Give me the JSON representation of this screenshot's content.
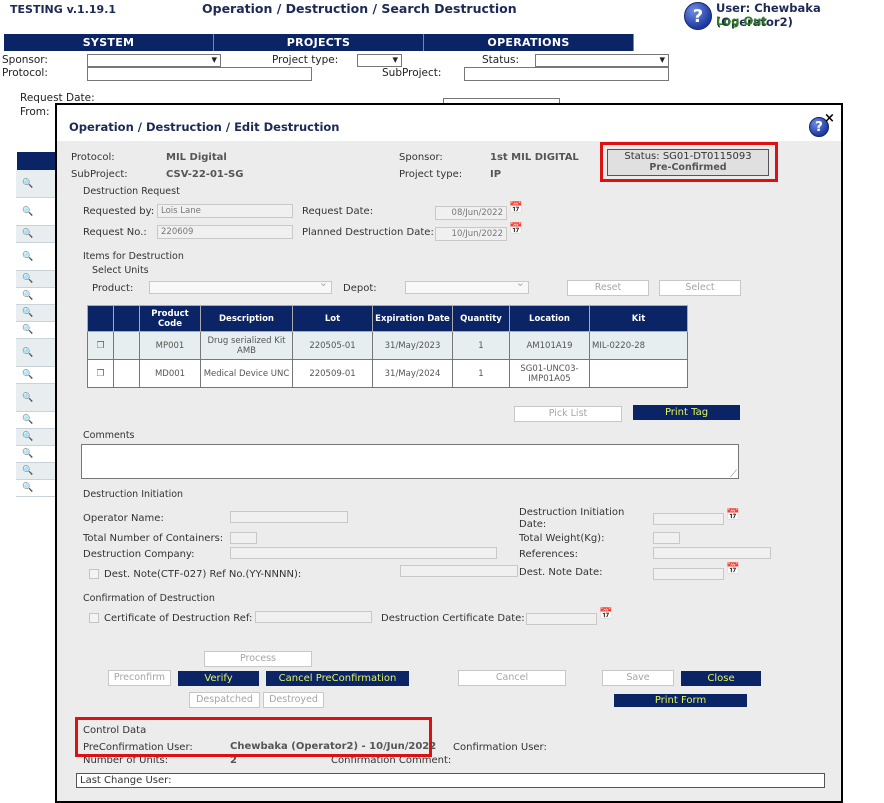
{
  "app": {
    "version": "TESTING v.1.19.1",
    "page_title": "Operation / Destruction / Search Destruction",
    "user": "User: Chewbaka (Operator2)",
    "logout": "Log Out"
  },
  "nav": {
    "tabs": [
      "SYSTEM",
      "PROJECTS",
      "OPERATIONS"
    ]
  },
  "search_form": {
    "sponsor_label": "Sponsor:",
    "project_type_label": "Project type:",
    "status_label": "Status:",
    "protocol_label": "Protocol:",
    "subproject_label": "SubProject:",
    "request_date_label": "Request Date:",
    "from_label": "From:"
  },
  "modal": {
    "title": "Operation / Destruction / Edit Destruction",
    "help": "?",
    "close": "×",
    "protocol_label": "Protocol:",
    "protocol_value": "MIL Digital",
    "subproject_label": "SubProject:",
    "subproject_value": "CSV-22-01-SG",
    "sponsor_label": "Sponsor:",
    "sponsor_value": "1st MIL DIGITAL",
    "project_type_label": "Project type:",
    "project_type_value": "IP",
    "status_text": "Status: SG01-DT0115093",
    "status_sub": "Pre-Confirmed"
  },
  "request": {
    "section": "Destruction Request",
    "requested_by_label": "Requested by:",
    "requested_by_value": "Lois Lane",
    "request_date_label": "Request Date:",
    "request_date_value": "08/Jun/2022",
    "request_no_label": "Request No.:",
    "request_no_value": "220609",
    "planned_date_label": "Planned Destruction Date:",
    "planned_date_value": "10/Jun/2022"
  },
  "items": {
    "section": "Items for Destruction",
    "select_units": "Select Units",
    "product_label": "Product:",
    "depot_label": "Depot:",
    "reset_button": "Reset",
    "select_button": "Select",
    "columns": [
      "Product Code",
      "Description",
      "Lot",
      "Expiration Date",
      "Quantity",
      "Location",
      "Kit"
    ],
    "rows": [
      {
        "code": "MP001",
        "description": "Drug serialized Kit AMB",
        "lot": "220505-01",
        "expiration": "31/May/2023",
        "quantity": "1",
        "location": "AM101A19",
        "kit": "MIL-0220-28"
      },
      {
        "code": "MD001",
        "description": "Medical Device UNC",
        "lot": "220509-01",
        "expiration": "31/May/2024",
        "quantity": "1",
        "location": "SG01-UNC03-IMP01A05",
        "kit": ""
      }
    ],
    "pick_list_button": "Pick List",
    "print_tag_button": "Print Tag"
  },
  "comments": {
    "label": "Comments"
  },
  "initiation": {
    "section": "Destruction Initiation",
    "operator_name_label": "Operator Name:",
    "total_containers_label": "Total Number of Containers:",
    "company_label": "Destruction Company:",
    "dest_note_label": "Dest. Note(CTF-027) Ref No.(YY-NNNN):",
    "initiation_date_label_1": "Destruction Initiation",
    "initiation_date_label_2": "Date:",
    "total_weight_label": "Total Weight(Kg):",
    "references_label": "References:",
    "dest_note_date_label": "Dest. Note Date:"
  },
  "confirmation": {
    "section": "Confirmation of Destruction",
    "certificate_ref_label": "Certificate of Destruction Ref:",
    "certificate_date_label": "Destruction Certificate Date:"
  },
  "actions": {
    "process": "Process",
    "preconfirm": "Preconfirm",
    "verify": "Verify",
    "cancel_preconfirmation": "Cancel PreConfirmation",
    "cancel": "Cancel",
    "save": "Save",
    "close": "Close",
    "despatched": "Despatched",
    "destroyed": "Destroyed",
    "print_form": "Print Form"
  },
  "control": {
    "section": "Control Data",
    "preconfirmation_user_label": "PreConfirmation User:",
    "preconfirmation_user_value": "Chewbaka (Operator2) - 10/Jun/2022",
    "confirmation_user_label": "Confirmation User:",
    "number_units_label": "Number of Units:",
    "number_units_value": "2",
    "confirmation_comment_label": "Confirmation Comment:",
    "last_change_label": "Last Change User:"
  },
  "colors": {
    "navy": "#0b2466",
    "highlight": "#dd1111",
    "logout_green": "#2f7d1e",
    "button_text_yellow": "#e2f55c"
  }
}
